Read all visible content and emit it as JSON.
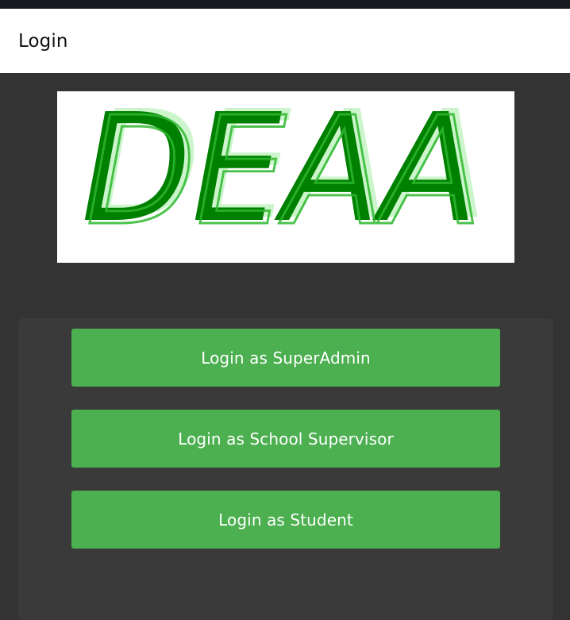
{
  "app_bar": {
    "title": "Login"
  },
  "logo": {
    "text": "DEAA",
    "colors": {
      "primary": "#008000",
      "shadow": "#ccf5cc",
      "highlight": "#2eb82e"
    }
  },
  "login_options": {
    "superadmin_label": "Login as SuperAdmin",
    "supervisor_label": "Login as School Supervisor",
    "student_label": "Login as Student"
  },
  "colors": {
    "background": "#333333",
    "card": "#3a3a3a",
    "button": "#4caf50",
    "status_bar": "#161a1e"
  }
}
